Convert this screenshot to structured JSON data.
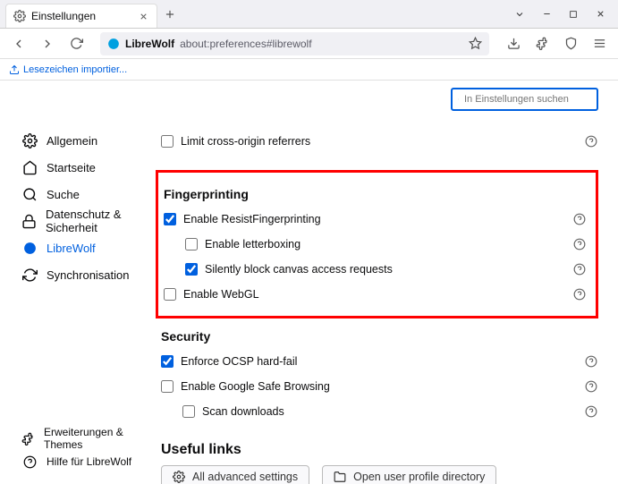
{
  "tab": {
    "title": "Einstellungen"
  },
  "url": {
    "site": "LibreWolf",
    "path": "about:preferences#librewolf"
  },
  "bookmarks": {
    "import": "Lesezeichen importier..."
  },
  "search": {
    "placeholder": "In Einstellungen suchen"
  },
  "sidebar": {
    "items": [
      {
        "label": "Allgemein"
      },
      {
        "label": "Startseite"
      },
      {
        "label": "Suche"
      },
      {
        "label": "Datenschutz & Sicherheit"
      },
      {
        "label": "LibreWolf"
      },
      {
        "label": "Synchronisation"
      }
    ],
    "bottom": [
      {
        "label": "Erweiterungen & Themes"
      },
      {
        "label": "Hilfe für LibreWolf"
      }
    ]
  },
  "sections": {
    "limit_referrers": "Limit cross-origin referrers",
    "fingerprinting": {
      "title": "Fingerprinting",
      "resist": "Enable ResistFingerprinting",
      "letterbox": "Enable letterboxing",
      "canvas": "Silently block canvas access requests",
      "webgl": "Enable WebGL"
    },
    "security": {
      "title": "Security",
      "ocsp": "Enforce OCSP hard-fail",
      "gsb": "Enable Google Safe Browsing",
      "scan": "Scan downloads"
    },
    "links": {
      "title": "Useful links",
      "advanced": "All advanced settings",
      "profile": "Open user profile directory"
    }
  }
}
